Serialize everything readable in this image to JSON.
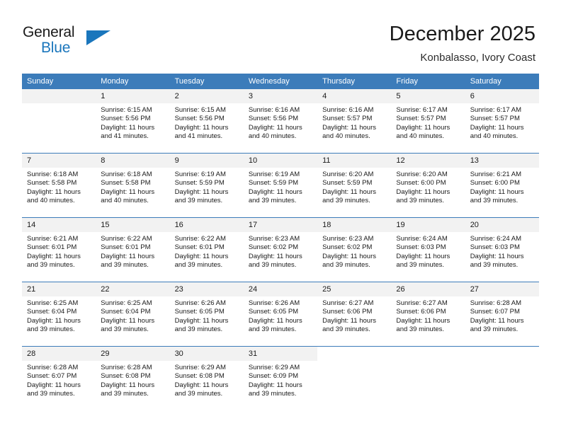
{
  "brand": {
    "name_part1": "General",
    "name_part2": "Blue",
    "logo_icon": "triangle-icon"
  },
  "header": {
    "month_title": "December 2025",
    "location": "Konbalasso, Ivory Coast"
  },
  "colors": {
    "header_blue": "#3c7cba",
    "brand_blue": "#1a76bc",
    "daynum_bg": "#f2f2f2",
    "text": "#1a1a1a"
  },
  "calendar": {
    "weekday_headers": [
      "Sunday",
      "Monday",
      "Tuesday",
      "Wednesday",
      "Thursday",
      "Friday",
      "Saturday"
    ],
    "weeks": [
      [
        {
          "day": "",
          "sunrise": "",
          "sunset": "",
          "daylight": "",
          "daylight2": "",
          "empty": true
        },
        {
          "day": "1",
          "sunrise": "Sunrise: 6:15 AM",
          "sunset": "Sunset: 5:56 PM",
          "daylight": "Daylight: 11 hours",
          "daylight2": "and 41 minutes."
        },
        {
          "day": "2",
          "sunrise": "Sunrise: 6:15 AM",
          "sunset": "Sunset: 5:56 PM",
          "daylight": "Daylight: 11 hours",
          "daylight2": "and 41 minutes."
        },
        {
          "day": "3",
          "sunrise": "Sunrise: 6:16 AM",
          "sunset": "Sunset: 5:56 PM",
          "daylight": "Daylight: 11 hours",
          "daylight2": "and 40 minutes."
        },
        {
          "day": "4",
          "sunrise": "Sunrise: 6:16 AM",
          "sunset": "Sunset: 5:57 PM",
          "daylight": "Daylight: 11 hours",
          "daylight2": "and 40 minutes."
        },
        {
          "day": "5",
          "sunrise": "Sunrise: 6:17 AM",
          "sunset": "Sunset: 5:57 PM",
          "daylight": "Daylight: 11 hours",
          "daylight2": "and 40 minutes."
        },
        {
          "day": "6",
          "sunrise": "Sunrise: 6:17 AM",
          "sunset": "Sunset: 5:57 PM",
          "daylight": "Daylight: 11 hours",
          "daylight2": "and 40 minutes."
        }
      ],
      [
        {
          "day": "7",
          "sunrise": "Sunrise: 6:18 AM",
          "sunset": "Sunset: 5:58 PM",
          "daylight": "Daylight: 11 hours",
          "daylight2": "and 40 minutes."
        },
        {
          "day": "8",
          "sunrise": "Sunrise: 6:18 AM",
          "sunset": "Sunset: 5:58 PM",
          "daylight": "Daylight: 11 hours",
          "daylight2": "and 40 minutes."
        },
        {
          "day": "9",
          "sunrise": "Sunrise: 6:19 AM",
          "sunset": "Sunset: 5:59 PM",
          "daylight": "Daylight: 11 hours",
          "daylight2": "and 39 minutes."
        },
        {
          "day": "10",
          "sunrise": "Sunrise: 6:19 AM",
          "sunset": "Sunset: 5:59 PM",
          "daylight": "Daylight: 11 hours",
          "daylight2": "and 39 minutes."
        },
        {
          "day": "11",
          "sunrise": "Sunrise: 6:20 AM",
          "sunset": "Sunset: 5:59 PM",
          "daylight": "Daylight: 11 hours",
          "daylight2": "and 39 minutes."
        },
        {
          "day": "12",
          "sunrise": "Sunrise: 6:20 AM",
          "sunset": "Sunset: 6:00 PM",
          "daylight": "Daylight: 11 hours",
          "daylight2": "and 39 minutes."
        },
        {
          "day": "13",
          "sunrise": "Sunrise: 6:21 AM",
          "sunset": "Sunset: 6:00 PM",
          "daylight": "Daylight: 11 hours",
          "daylight2": "and 39 minutes."
        }
      ],
      [
        {
          "day": "14",
          "sunrise": "Sunrise: 6:21 AM",
          "sunset": "Sunset: 6:01 PM",
          "daylight": "Daylight: 11 hours",
          "daylight2": "and 39 minutes."
        },
        {
          "day": "15",
          "sunrise": "Sunrise: 6:22 AM",
          "sunset": "Sunset: 6:01 PM",
          "daylight": "Daylight: 11 hours",
          "daylight2": "and 39 minutes."
        },
        {
          "day": "16",
          "sunrise": "Sunrise: 6:22 AM",
          "sunset": "Sunset: 6:01 PM",
          "daylight": "Daylight: 11 hours",
          "daylight2": "and 39 minutes."
        },
        {
          "day": "17",
          "sunrise": "Sunrise: 6:23 AM",
          "sunset": "Sunset: 6:02 PM",
          "daylight": "Daylight: 11 hours",
          "daylight2": "and 39 minutes."
        },
        {
          "day": "18",
          "sunrise": "Sunrise: 6:23 AM",
          "sunset": "Sunset: 6:02 PM",
          "daylight": "Daylight: 11 hours",
          "daylight2": "and 39 minutes."
        },
        {
          "day": "19",
          "sunrise": "Sunrise: 6:24 AM",
          "sunset": "Sunset: 6:03 PM",
          "daylight": "Daylight: 11 hours",
          "daylight2": "and 39 minutes."
        },
        {
          "day": "20",
          "sunrise": "Sunrise: 6:24 AM",
          "sunset": "Sunset: 6:03 PM",
          "daylight": "Daylight: 11 hours",
          "daylight2": "and 39 minutes."
        }
      ],
      [
        {
          "day": "21",
          "sunrise": "Sunrise: 6:25 AM",
          "sunset": "Sunset: 6:04 PM",
          "daylight": "Daylight: 11 hours",
          "daylight2": "and 39 minutes."
        },
        {
          "day": "22",
          "sunrise": "Sunrise: 6:25 AM",
          "sunset": "Sunset: 6:04 PM",
          "daylight": "Daylight: 11 hours",
          "daylight2": "and 39 minutes."
        },
        {
          "day": "23",
          "sunrise": "Sunrise: 6:26 AM",
          "sunset": "Sunset: 6:05 PM",
          "daylight": "Daylight: 11 hours",
          "daylight2": "and 39 minutes."
        },
        {
          "day": "24",
          "sunrise": "Sunrise: 6:26 AM",
          "sunset": "Sunset: 6:05 PM",
          "daylight": "Daylight: 11 hours",
          "daylight2": "and 39 minutes."
        },
        {
          "day": "25",
          "sunrise": "Sunrise: 6:27 AM",
          "sunset": "Sunset: 6:06 PM",
          "daylight": "Daylight: 11 hours",
          "daylight2": "and 39 minutes."
        },
        {
          "day": "26",
          "sunrise": "Sunrise: 6:27 AM",
          "sunset": "Sunset: 6:06 PM",
          "daylight": "Daylight: 11 hours",
          "daylight2": "and 39 minutes."
        },
        {
          "day": "27",
          "sunrise": "Sunrise: 6:28 AM",
          "sunset": "Sunset: 6:07 PM",
          "daylight": "Daylight: 11 hours",
          "daylight2": "and 39 minutes."
        }
      ],
      [
        {
          "day": "28",
          "sunrise": "Sunrise: 6:28 AM",
          "sunset": "Sunset: 6:07 PM",
          "daylight": "Daylight: 11 hours",
          "daylight2": "and 39 minutes."
        },
        {
          "day": "29",
          "sunrise": "Sunrise: 6:28 AM",
          "sunset": "Sunset: 6:08 PM",
          "daylight": "Daylight: 11 hours",
          "daylight2": "and 39 minutes."
        },
        {
          "day": "30",
          "sunrise": "Sunrise: 6:29 AM",
          "sunset": "Sunset: 6:08 PM",
          "daylight": "Daylight: 11 hours",
          "daylight2": "and 39 minutes."
        },
        {
          "day": "31",
          "sunrise": "Sunrise: 6:29 AM",
          "sunset": "Sunset: 6:09 PM",
          "daylight": "Daylight: 11 hours",
          "daylight2": "and 39 minutes."
        },
        {
          "day": "",
          "sunrise": "",
          "sunset": "",
          "daylight": "",
          "daylight2": "",
          "blank": true
        },
        {
          "day": "",
          "sunrise": "",
          "sunset": "",
          "daylight": "",
          "daylight2": "",
          "blank": true
        },
        {
          "day": "",
          "sunrise": "",
          "sunset": "",
          "daylight": "",
          "daylight2": "",
          "blank": true
        }
      ]
    ]
  }
}
